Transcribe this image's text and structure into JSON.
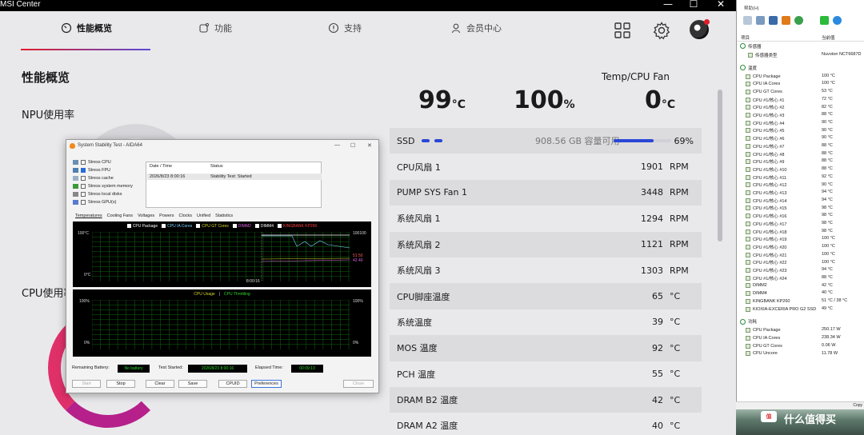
{
  "window": {
    "title": "MSI Center",
    "min": "—",
    "max": "☐",
    "close": "✕"
  },
  "nav": {
    "tabs": [
      {
        "label": "性能概览",
        "icon": "gauge-icon"
      },
      {
        "label": "功能",
        "icon": "feature-icon"
      },
      {
        "label": "支持",
        "icon": "support-icon"
      },
      {
        "label": "会员中心",
        "icon": "user-icon"
      }
    ]
  },
  "page": {
    "title": "性能概览",
    "npu_label": "NPU使用率",
    "cpu_label": "CPU使用率"
  },
  "summary": {
    "fan_label": "Temp/CPU Fan",
    "cpu_temp": "99",
    "cpu_temp_unit": "°C",
    "cpu_usage": "100",
    "cpu_usage_unit": "%",
    "fan_value": "0",
    "fan_unit": "°C"
  },
  "ssd": {
    "label": "SSD",
    "capacity": "908.56 GB 容量可用",
    "percent": "69%",
    "fill": 0.69
  },
  "sensors": [
    {
      "label": "CPU风扇 1",
      "value": "1901",
      "unit": "RPM"
    },
    {
      "label": "PUMP SYS Fan 1",
      "value": "3448",
      "unit": "RPM"
    },
    {
      "label": "系统风扇 1",
      "value": "1294",
      "unit": "RPM"
    },
    {
      "label": "系统风扇 2",
      "value": "1121",
      "unit": "RPM"
    },
    {
      "label": "系统风扇 3",
      "value": "1303",
      "unit": "RPM"
    },
    {
      "label": "CPU脚座温度",
      "value": "65",
      "unit": "°C"
    },
    {
      "label": "系统温度",
      "value": "39",
      "unit": "°C"
    },
    {
      "label": "MOS 温度",
      "value": "92",
      "unit": "°C"
    },
    {
      "label": "PCH 温度",
      "value": "55",
      "unit": "°C"
    },
    {
      "label": "DRAM B2 温度",
      "value": "42",
      "unit": "°C"
    },
    {
      "label": "DRAM A2 温度",
      "value": "40",
      "unit": "°C"
    }
  ],
  "aida": {
    "title": "System Stability Test - AIDA64",
    "stress": [
      {
        "label": "Stress CPU",
        "checked": false
      },
      {
        "label": "Stress FPU",
        "checked": true
      },
      {
        "label": "Stress cache",
        "checked": false
      },
      {
        "label": "Stress system memory",
        "checked": false
      },
      {
        "label": "Stress local disks",
        "checked": false
      },
      {
        "label": "Stress GPU(s)",
        "checked": false
      }
    ],
    "log_headers": {
      "date": "Date / Time",
      "status": "Status"
    },
    "log_row": {
      "date": "2026/8/23 8:00:16",
      "status": "Stability Test: Started"
    },
    "tabs": [
      "Temperatures",
      "Cooling Fans",
      "Voltages",
      "Powers",
      "Clocks",
      "Unified",
      "Statistics"
    ],
    "legend": [
      {
        "label": "CPU Package",
        "color": "#ffffff"
      },
      {
        "label": "CPU IA Cores",
        "color": "#7fd6ff"
      },
      {
        "label": "CPU GT Cores",
        "color": "#d6d62c"
      },
      {
        "label": "DIMM2",
        "color": "#e060e0"
      },
      {
        "label": "DIMM4",
        "color": "#ffffff"
      },
      {
        "label": "KINGBANK KP260",
        "color": "#ff4040"
      }
    ],
    "temp_graph": {
      "ymax": "100°C",
      "ymin": "0°C",
      "xtime": "8:00:16",
      "right_top": "100100",
      "right_a": "51 50",
      "right_b": "42 40"
    },
    "usage_graph": {
      "title_a": "CPU Usage",
      "title_sep": "|",
      "title_b": "CPU Throttling",
      "ymax": "100%",
      "ymin": "0%",
      "rmax": "100%",
      "rmin": "0%"
    },
    "status": {
      "battery_label": "Remaining Battery:",
      "battery_value": "No battery",
      "started_label": "Test Started:",
      "started_value": "2026/8/23 8:00:16",
      "elapsed_label": "Elapsed Time:",
      "elapsed_value": "00:09:13"
    },
    "buttons": {
      "start": "Start",
      "stop": "Stop",
      "clear": "Clear",
      "save": "Save",
      "cpuid": "CPUID",
      "prefs": "Preferences",
      "close": "Close"
    }
  },
  "hwinfo": {
    "menu": "帮助(H)",
    "col_item": "项目",
    "col_value": "当前值",
    "rows": [
      {
        "label": "传感器",
        "value": "",
        "kind": "group"
      },
      {
        "label": "传感器类型",
        "value": "Nuvoton NCT6687D",
        "kind": "item",
        "indent": 2
      },
      {
        "label": "",
        "value": "",
        "kind": "spacer"
      },
      {
        "label": "温度",
        "value": "",
        "kind": "group"
      },
      {
        "label": "CPU Package",
        "value": "100 °C",
        "kind": "item",
        "indent": 1
      },
      {
        "label": "CPU IA Cores",
        "value": "100 °C",
        "kind": "item",
        "indent": 1
      },
      {
        "label": "CPU GT Cores",
        "value": "53 °C",
        "kind": "item",
        "indent": 1
      },
      {
        "label": "CPU #1/核心 #1",
        "value": "72 °C",
        "kind": "item",
        "indent": 1
      },
      {
        "label": "CPU #1/核心 #2",
        "value": "82 °C",
        "kind": "item",
        "indent": 1
      },
      {
        "label": "CPU #1/核心 #3",
        "value": "88 °C",
        "kind": "item",
        "indent": 1
      },
      {
        "label": "CPU #1/核心 #4",
        "value": "90 °C",
        "kind": "item",
        "indent": 1
      },
      {
        "label": "CPU #1/核心 #5",
        "value": "90 °C",
        "kind": "item",
        "indent": 1
      },
      {
        "label": "CPU #1/核心 #6",
        "value": "90 °C",
        "kind": "item",
        "indent": 1
      },
      {
        "label": "CPU #1/核心 #7",
        "value": "88 °C",
        "kind": "item",
        "indent": 1
      },
      {
        "label": "CPU #1/核心 #8",
        "value": "88 °C",
        "kind": "item",
        "indent": 1
      },
      {
        "label": "CPU #1/核心 #9",
        "value": "88 °C",
        "kind": "item",
        "indent": 1
      },
      {
        "label": "CPU #1/核心 #10",
        "value": "88 °C",
        "kind": "item",
        "indent": 1
      },
      {
        "label": "CPU #1/核心 #11",
        "value": "92 °C",
        "kind": "item",
        "indent": 1
      },
      {
        "label": "CPU #1/核心 #12",
        "value": "90 °C",
        "kind": "item",
        "indent": 1
      },
      {
        "label": "CPU #1/核心 #13",
        "value": "94 °C",
        "kind": "item",
        "indent": 1
      },
      {
        "label": "CPU #1/核心 #14",
        "value": "94 °C",
        "kind": "item",
        "indent": 1
      },
      {
        "label": "CPU #1/核心 #15",
        "value": "98 °C",
        "kind": "item",
        "indent": 1
      },
      {
        "label": "CPU #1/核心 #16",
        "value": "98 °C",
        "kind": "item",
        "indent": 1
      },
      {
        "label": "CPU #1/核心 #17",
        "value": "98 °C",
        "kind": "item",
        "indent": 1
      },
      {
        "label": "CPU #1/核心 #18",
        "value": "98 °C",
        "kind": "item",
        "indent": 1
      },
      {
        "label": "CPU #1/核心 #19",
        "value": "100 °C",
        "kind": "item",
        "indent": 1
      },
      {
        "label": "CPU #1/核心 #20",
        "value": "100 °C",
        "kind": "item",
        "indent": 1
      },
      {
        "label": "CPU #1/核心 #21",
        "value": "100 °C",
        "kind": "item",
        "indent": 1
      },
      {
        "label": "CPU #1/核心 #22",
        "value": "100 °C",
        "kind": "item",
        "indent": 1
      },
      {
        "label": "CPU #1/核心 #23",
        "value": "94 °C",
        "kind": "item",
        "indent": 1
      },
      {
        "label": "CPU #1/核心 #24",
        "value": "88 °C",
        "kind": "item",
        "indent": 1
      },
      {
        "label": "DIMM2",
        "value": "42 °C",
        "kind": "item",
        "indent": 1
      },
      {
        "label": "DIMM4",
        "value": "40 °C",
        "kind": "item",
        "indent": 1
      },
      {
        "label": "KINGBANK KP260",
        "value": "51 °C / 38 °C",
        "kind": "item",
        "indent": 1
      },
      {
        "label": "KIOXIA-EXCERIA PRO G2 SSD",
        "value": "49 °C",
        "kind": "item",
        "indent": 1
      },
      {
        "label": "",
        "value": "",
        "kind": "spacer"
      },
      {
        "label": "功耗",
        "value": "",
        "kind": "group"
      },
      {
        "label": "CPU Package",
        "value": "250.17 W",
        "kind": "item",
        "indent": 1
      },
      {
        "label": "CPU IA Cores",
        "value": "238.34 W",
        "kind": "item",
        "indent": 1
      },
      {
        "label": "CPU GT Cores",
        "value": "0.06 W",
        "kind": "item",
        "indent": 1
      },
      {
        "label": "CPU Uncore",
        "value": "11.78 W",
        "kind": "item",
        "indent": 1
      }
    ],
    "copy": "Copy",
    "wallpaper_text": "什么值得买",
    "wallpaper_logo": "值"
  }
}
